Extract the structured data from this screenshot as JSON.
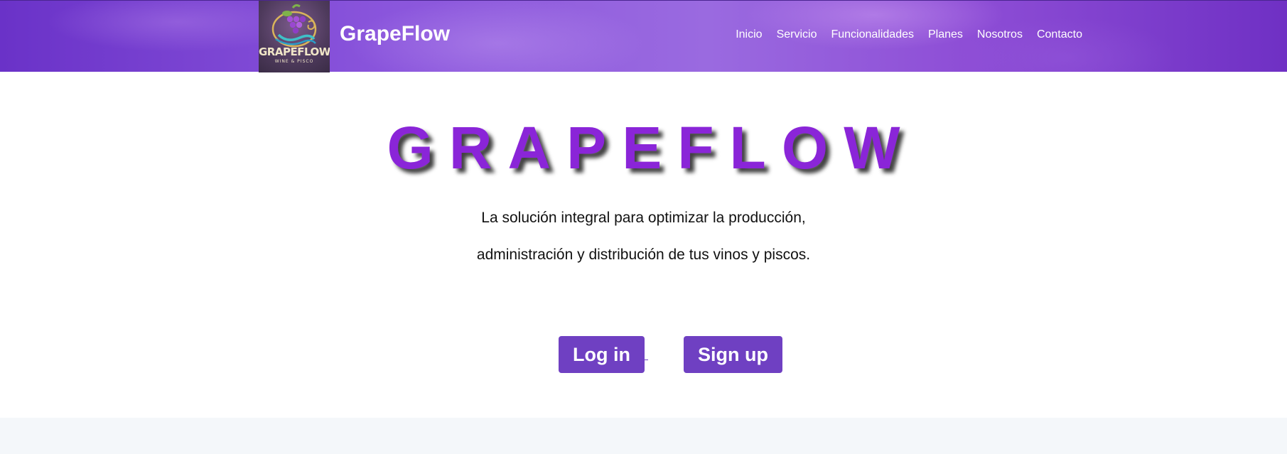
{
  "header": {
    "logo": {
      "line1": "GRAPEFLOW",
      "line2": "WINE & PISCO"
    },
    "brand": "GrapeFlow",
    "nav": [
      "Inicio",
      "Servicio",
      "Funcionalidades",
      "Planes",
      "Nosotros",
      "Contacto"
    ]
  },
  "hero": {
    "title": "GRAPEFLOW",
    "subtitle_line1": "La solución integral para optimizar la producción,",
    "subtitle_line2": "administración y distribución de tus vinos y piscos."
  },
  "actions": {
    "login_label": "Log in",
    "signup_label": "Sign up"
  },
  "colors": {
    "accent": "#8a25d8",
    "button": "#6f40c2",
    "navbar": "#8a55dc"
  }
}
